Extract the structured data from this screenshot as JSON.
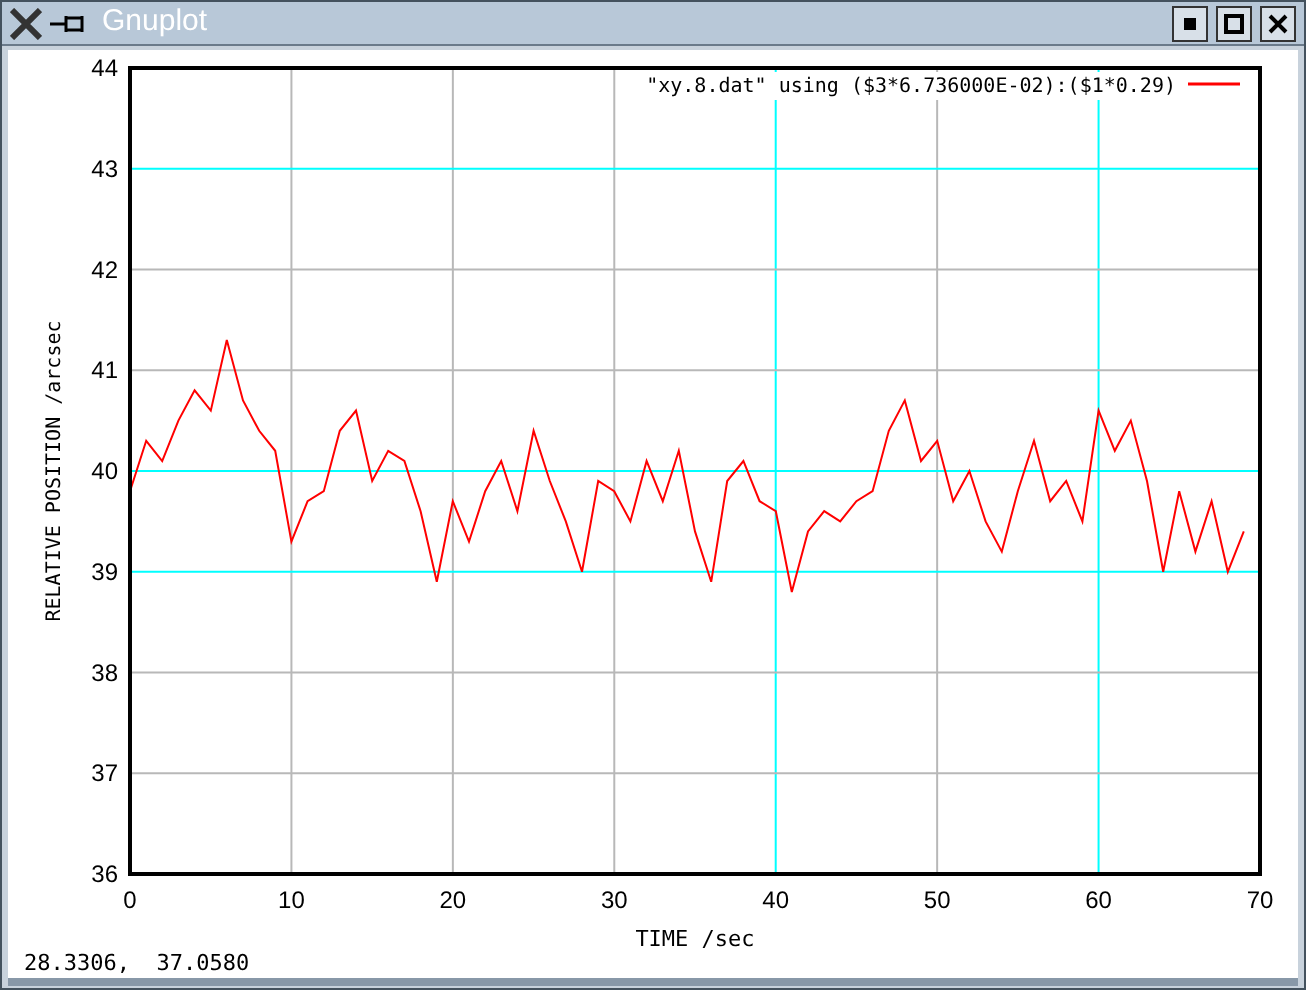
{
  "window": {
    "title": "Gnuplot"
  },
  "plot": {
    "chart_data": {
      "type": "line",
      "xlabel": "TIME /sec",
      "ylabel": "RELATIVE POSITION /arcsec",
      "xlim": [
        0,
        70
      ],
      "ylim": [
        36,
        44
      ],
      "xticks": [
        0,
        10,
        20,
        30,
        40,
        50,
        60,
        70
      ],
      "yticks": [
        36,
        37,
        38,
        39,
        40,
        41,
        42,
        43,
        44
      ],
      "grid": true,
      "x": [
        0,
        1,
        2,
        3,
        4,
        5,
        6,
        7,
        8,
        9,
        10,
        11,
        12,
        13,
        14,
        15,
        16,
        17,
        18,
        19,
        20,
        21,
        22,
        23,
        24,
        25,
        26,
        27,
        28,
        29,
        30,
        31,
        32,
        33,
        34,
        35,
        36,
        37,
        38,
        39,
        40,
        41,
        42,
        43,
        44,
        45,
        46,
        47,
        48,
        49,
        50,
        51,
        52,
        53,
        54,
        55,
        56,
        57,
        58,
        59,
        60,
        61,
        62,
        63,
        64,
        65,
        66,
        67,
        68,
        69
      ],
      "series": [
        {
          "name": "\"xy.8.dat\" using ($3*6.736000E-02):($1*0.29)",
          "color": "#ff0000",
          "values": [
            39.8,
            40.3,
            40.1,
            40.5,
            40.8,
            40.6,
            41.3,
            40.7,
            40.4,
            40.2,
            39.3,
            39.7,
            39.8,
            40.4,
            40.6,
            39.9,
            40.2,
            40.1,
            39.6,
            38.9,
            39.7,
            39.3,
            39.8,
            40.1,
            39.6,
            40.4,
            39.9,
            39.5,
            39.0,
            39.9,
            39.8,
            39.5,
            40.1,
            39.7,
            40.2,
            39.4,
            38.9,
            39.9,
            40.1,
            39.7,
            39.6,
            38.8,
            39.4,
            39.6,
            39.5,
            39.7,
            39.8,
            40.4,
            40.7,
            40.1,
            40.3,
            39.7,
            40.0,
            39.5,
            39.2,
            39.8,
            40.3,
            39.7,
            39.9,
            39.5,
            40.6,
            40.2,
            40.5,
            39.9,
            39.0,
            39.8,
            39.2,
            39.7,
            39.0,
            39.4
          ]
        }
      ]
    }
  },
  "status_bar": {
    "coordinates": "28.3306,  37.0580"
  }
}
